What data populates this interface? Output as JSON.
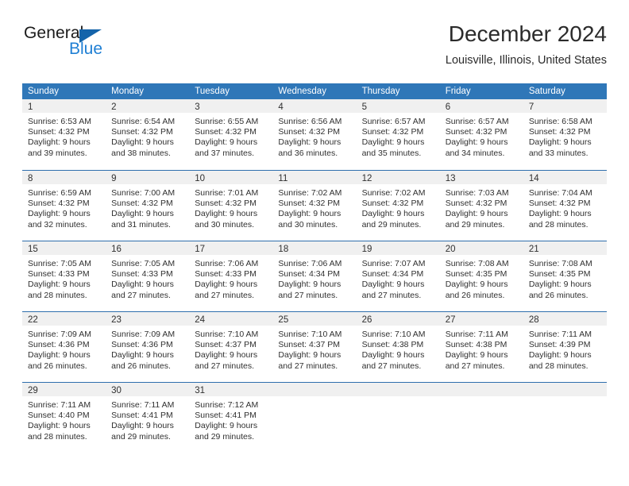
{
  "logo": {
    "word_one": "General",
    "word_two": "Blue",
    "triangle_color": "#1464aa",
    "blue_color": "#1f7fd4"
  },
  "header": {
    "title": "December 2024",
    "subtitle": "Louisville, Illinois, United States"
  },
  "theme": {
    "header_bg": "#2f77b8",
    "row_divider": "#2f6fad",
    "day_strip_bg": "#f0f0f0"
  },
  "weekdays": [
    "Sunday",
    "Monday",
    "Tuesday",
    "Wednesday",
    "Thursday",
    "Friday",
    "Saturday"
  ],
  "weeks": [
    [
      {
        "day": "1",
        "lines": [
          "Sunrise: 6:53 AM",
          "Sunset: 4:32 PM",
          "Daylight: 9 hours",
          "and 39 minutes."
        ]
      },
      {
        "day": "2",
        "lines": [
          "Sunrise: 6:54 AM",
          "Sunset: 4:32 PM",
          "Daylight: 9 hours",
          "and 38 minutes."
        ]
      },
      {
        "day": "3",
        "lines": [
          "Sunrise: 6:55 AM",
          "Sunset: 4:32 PM",
          "Daylight: 9 hours",
          "and 37 minutes."
        ]
      },
      {
        "day": "4",
        "lines": [
          "Sunrise: 6:56 AM",
          "Sunset: 4:32 PM",
          "Daylight: 9 hours",
          "and 36 minutes."
        ]
      },
      {
        "day": "5",
        "lines": [
          "Sunrise: 6:57 AM",
          "Sunset: 4:32 PM",
          "Daylight: 9 hours",
          "and 35 minutes."
        ]
      },
      {
        "day": "6",
        "lines": [
          "Sunrise: 6:57 AM",
          "Sunset: 4:32 PM",
          "Daylight: 9 hours",
          "and 34 minutes."
        ]
      },
      {
        "day": "7",
        "lines": [
          "Sunrise: 6:58 AM",
          "Sunset: 4:32 PM",
          "Daylight: 9 hours",
          "and 33 minutes."
        ]
      }
    ],
    [
      {
        "day": "8",
        "lines": [
          "Sunrise: 6:59 AM",
          "Sunset: 4:32 PM",
          "Daylight: 9 hours",
          "and 32 minutes."
        ]
      },
      {
        "day": "9",
        "lines": [
          "Sunrise: 7:00 AM",
          "Sunset: 4:32 PM",
          "Daylight: 9 hours",
          "and 31 minutes."
        ]
      },
      {
        "day": "10",
        "lines": [
          "Sunrise: 7:01 AM",
          "Sunset: 4:32 PM",
          "Daylight: 9 hours",
          "and 30 minutes."
        ]
      },
      {
        "day": "11",
        "lines": [
          "Sunrise: 7:02 AM",
          "Sunset: 4:32 PM",
          "Daylight: 9 hours",
          "and 30 minutes."
        ]
      },
      {
        "day": "12",
        "lines": [
          "Sunrise: 7:02 AM",
          "Sunset: 4:32 PM",
          "Daylight: 9 hours",
          "and 29 minutes."
        ]
      },
      {
        "day": "13",
        "lines": [
          "Sunrise: 7:03 AM",
          "Sunset: 4:32 PM",
          "Daylight: 9 hours",
          "and 29 minutes."
        ]
      },
      {
        "day": "14",
        "lines": [
          "Sunrise: 7:04 AM",
          "Sunset: 4:32 PM",
          "Daylight: 9 hours",
          "and 28 minutes."
        ]
      }
    ],
    [
      {
        "day": "15",
        "lines": [
          "Sunrise: 7:05 AM",
          "Sunset: 4:33 PM",
          "Daylight: 9 hours",
          "and 28 minutes."
        ]
      },
      {
        "day": "16",
        "lines": [
          "Sunrise: 7:05 AM",
          "Sunset: 4:33 PM",
          "Daylight: 9 hours",
          "and 27 minutes."
        ]
      },
      {
        "day": "17",
        "lines": [
          "Sunrise: 7:06 AM",
          "Sunset: 4:33 PM",
          "Daylight: 9 hours",
          "and 27 minutes."
        ]
      },
      {
        "day": "18",
        "lines": [
          "Sunrise: 7:06 AM",
          "Sunset: 4:34 PM",
          "Daylight: 9 hours",
          "and 27 minutes."
        ]
      },
      {
        "day": "19",
        "lines": [
          "Sunrise: 7:07 AM",
          "Sunset: 4:34 PM",
          "Daylight: 9 hours",
          "and 27 minutes."
        ]
      },
      {
        "day": "20",
        "lines": [
          "Sunrise: 7:08 AM",
          "Sunset: 4:35 PM",
          "Daylight: 9 hours",
          "and 26 minutes."
        ]
      },
      {
        "day": "21",
        "lines": [
          "Sunrise: 7:08 AM",
          "Sunset: 4:35 PM",
          "Daylight: 9 hours",
          "and 26 minutes."
        ]
      }
    ],
    [
      {
        "day": "22",
        "lines": [
          "Sunrise: 7:09 AM",
          "Sunset: 4:36 PM",
          "Daylight: 9 hours",
          "and 26 minutes."
        ]
      },
      {
        "day": "23",
        "lines": [
          "Sunrise: 7:09 AM",
          "Sunset: 4:36 PM",
          "Daylight: 9 hours",
          "and 26 minutes."
        ]
      },
      {
        "day": "24",
        "lines": [
          "Sunrise: 7:10 AM",
          "Sunset: 4:37 PM",
          "Daylight: 9 hours",
          "and 27 minutes."
        ]
      },
      {
        "day": "25",
        "lines": [
          "Sunrise: 7:10 AM",
          "Sunset: 4:37 PM",
          "Daylight: 9 hours",
          "and 27 minutes."
        ]
      },
      {
        "day": "26",
        "lines": [
          "Sunrise: 7:10 AM",
          "Sunset: 4:38 PM",
          "Daylight: 9 hours",
          "and 27 minutes."
        ]
      },
      {
        "day": "27",
        "lines": [
          "Sunrise: 7:11 AM",
          "Sunset: 4:38 PM",
          "Daylight: 9 hours",
          "and 27 minutes."
        ]
      },
      {
        "day": "28",
        "lines": [
          "Sunrise: 7:11 AM",
          "Sunset: 4:39 PM",
          "Daylight: 9 hours",
          "and 28 minutes."
        ]
      }
    ],
    [
      {
        "day": "29",
        "lines": [
          "Sunrise: 7:11 AM",
          "Sunset: 4:40 PM",
          "Daylight: 9 hours",
          "and 28 minutes."
        ]
      },
      {
        "day": "30",
        "lines": [
          "Sunrise: 7:11 AM",
          "Sunset: 4:41 PM",
          "Daylight: 9 hours",
          "and 29 minutes."
        ]
      },
      {
        "day": "31",
        "lines": [
          "Sunrise: 7:12 AM",
          "Sunset: 4:41 PM",
          "Daylight: 9 hours",
          "and 29 minutes."
        ]
      },
      {
        "day": "",
        "lines": []
      },
      {
        "day": "",
        "lines": []
      },
      {
        "day": "",
        "lines": []
      },
      {
        "day": "",
        "lines": []
      }
    ]
  ]
}
